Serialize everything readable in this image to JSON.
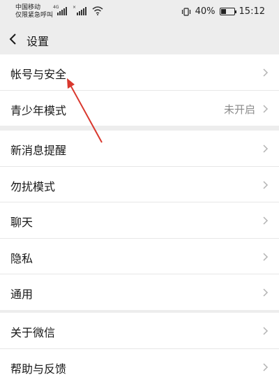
{
  "status_bar": {
    "carrier_line1": "中国移动",
    "carrier_line2": "仅限紧急呼叫",
    "network_tag_1": "4G",
    "network_tag_2": "×",
    "battery_percent_text": "40%",
    "battery_level": 0.4,
    "time": "15:12"
  },
  "header": {
    "title": "设置"
  },
  "groups": [
    {
      "items": [
        {
          "label": "帐号与安全",
          "value": ""
        },
        {
          "label": "青少年模式",
          "value": "未开启"
        }
      ]
    },
    {
      "items": [
        {
          "label": "新消息提醒"
        },
        {
          "label": "勿扰模式"
        },
        {
          "label": "聊天"
        },
        {
          "label": "隐私"
        },
        {
          "label": "通用"
        }
      ]
    },
    {
      "items": [
        {
          "label": "关于微信"
        },
        {
          "label": "帮助与反馈"
        }
      ]
    }
  ],
  "colors": {
    "background": "#ededed",
    "annotation_arrow": "#d9382e"
  }
}
